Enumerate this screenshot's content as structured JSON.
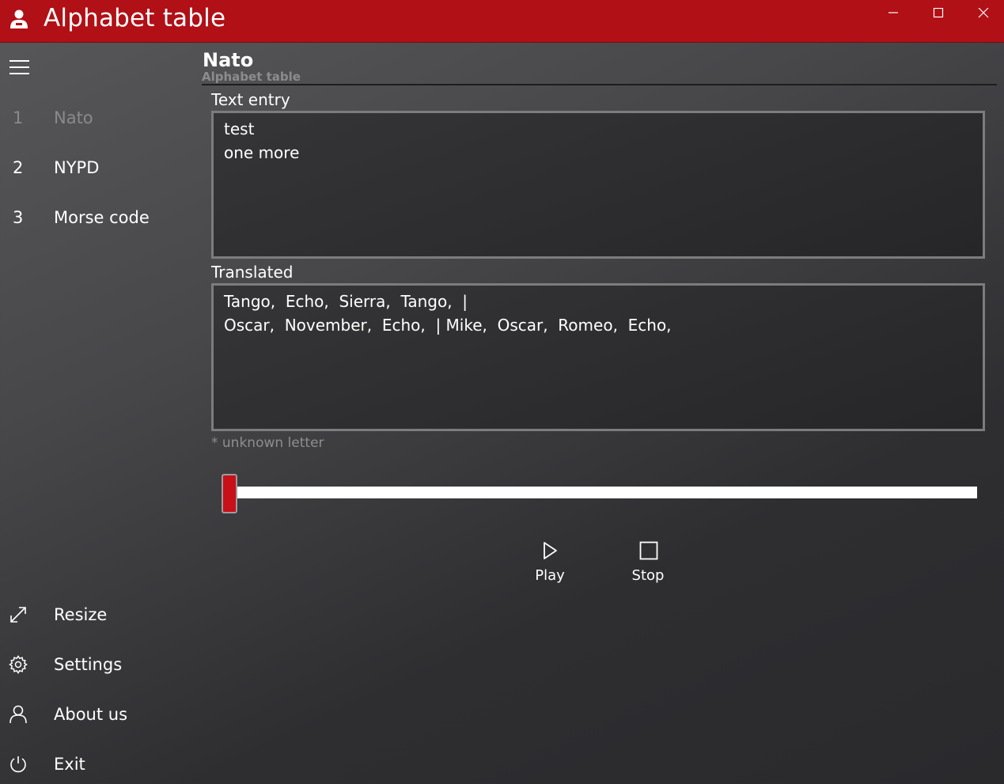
{
  "window": {
    "title": "Alphabet table",
    "app_icon": "person-icon",
    "controls": [
      "minimize-icon",
      "maximize-icon",
      "close-icon"
    ],
    "titlebar_color": "#b01016"
  },
  "sidebar": {
    "menu_icon": "hamburger-icon",
    "items": [
      {
        "number": "1",
        "label": "Nato",
        "enabled": false
      },
      {
        "number": "2",
        "label": "NYPD",
        "enabled": true
      },
      {
        "number": "3",
        "label": "Morse code",
        "enabled": true
      }
    ],
    "bottom_items": [
      {
        "label": "Resize",
        "icon": "resize-icon"
      },
      {
        "label": "Settings",
        "icon": "gear-icon"
      },
      {
        "label": "About us",
        "icon": "person-icon"
      },
      {
        "label": "Exit",
        "icon": "power-icon"
      }
    ]
  },
  "header": {
    "title": "Nato",
    "subtitle": "Alphabet table"
  },
  "text_entry": {
    "label": "Text entry",
    "lines": [
      "test",
      "one more"
    ]
  },
  "translated": {
    "label": "Translated",
    "lines": [
      "Tango,  Echo,  Sierra,  Tango,  |",
      "Oscar,  November,  Echo,  | Mike,  Oscar,  Romeo,  Echo,"
    ]
  },
  "hint": "* unknown letter",
  "playback": {
    "progress": 0.0,
    "accent_color": "#c81018",
    "play_label": "Play",
    "play_icon": "play-icon",
    "stop_label": "Stop",
    "stop_icon": "stop-icon"
  }
}
